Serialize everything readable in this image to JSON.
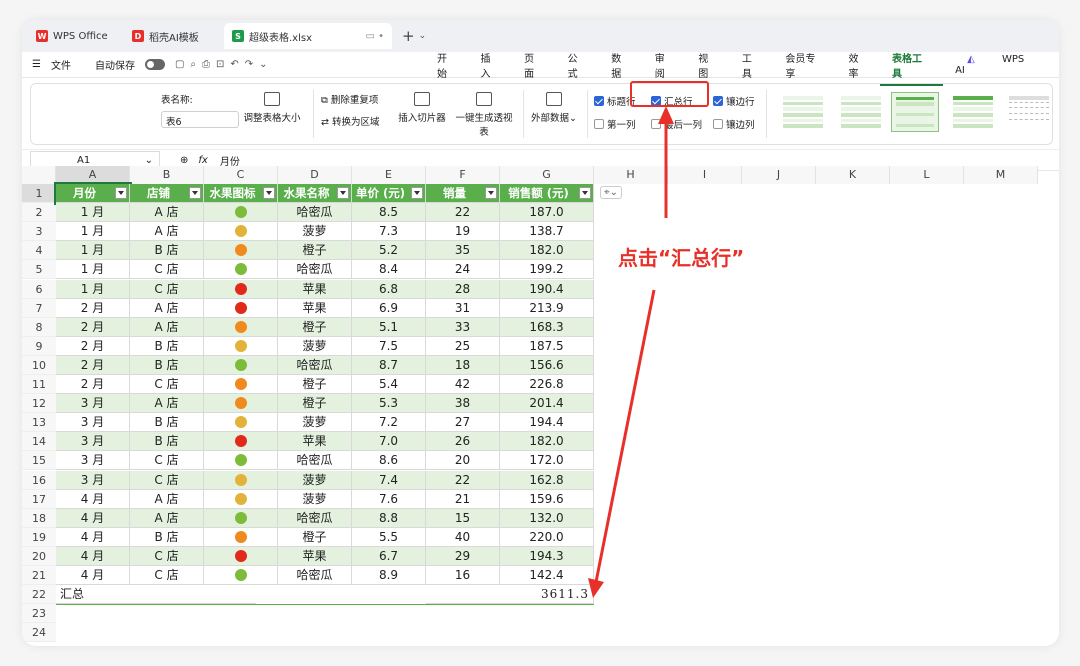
{
  "tabs": [
    {
      "label": "WPS Office",
      "icon": "wps-logo-icon"
    },
    {
      "label": "稻壳AI模板",
      "icon": "docer-icon"
    },
    {
      "label": "超级表格.xlsx",
      "icon": "spreadsheet-icon"
    }
  ],
  "menubar": {
    "file": "文件",
    "autosave": "自动保存",
    "menus": [
      "开始",
      "插入",
      "页面",
      "公式",
      "数据",
      "审阅",
      "视图",
      "工具",
      "会员专享",
      "效率",
      "表格工具"
    ],
    "wpsai": "WPS AI"
  },
  "ribbon": {
    "table_name_label": "表名称:",
    "table_name_value": "表6",
    "resize": "调整表格大小",
    "remove_dup": "删除重复项",
    "convert": "转换为区域",
    "slicer": "插入切片器",
    "pivot": "一键生成透视表",
    "external": "外部数据",
    "opts": {
      "header_row": "标题行",
      "total_row": "汇总行",
      "banded_rows": "镶边行",
      "first_col": "第一列",
      "last_col": "最后一列",
      "banded_cols": "镶边列"
    }
  },
  "formula_bar": {
    "cell_ref": "A1",
    "fx": "fx",
    "content": "月份"
  },
  "columns": [
    "A",
    "B",
    "C",
    "D",
    "E",
    "F",
    "G",
    "H",
    "I",
    "J",
    "K",
    "L",
    "M"
  ],
  "headers": [
    "月份",
    "店铺",
    "水果图标",
    "水果名称",
    "单价 (元)",
    "销量",
    "销售额 (元)"
  ],
  "rows": [
    [
      "1 月",
      "A 店",
      "melon",
      "哈密瓜",
      "8.5",
      "22",
      "187.0"
    ],
    [
      "1 月",
      "A 店",
      "pineapple",
      "菠萝",
      "7.3",
      "19",
      "138.7"
    ],
    [
      "1 月",
      "B 店",
      "orange",
      "橙子",
      "5.2",
      "35",
      "182.0"
    ],
    [
      "1 月",
      "C 店",
      "melon",
      "哈密瓜",
      "8.4",
      "24",
      "199.2"
    ],
    [
      "1 月",
      "C 店",
      "apple",
      "苹果",
      "6.8",
      "28",
      "190.4"
    ],
    [
      "2 月",
      "A 店",
      "apple",
      "苹果",
      "6.9",
      "31",
      "213.9"
    ],
    [
      "2 月",
      "A 店",
      "orange",
      "橙子",
      "5.1",
      "33",
      "168.3"
    ],
    [
      "2 月",
      "B 店",
      "pineapple",
      "菠萝",
      "7.5",
      "25",
      "187.5"
    ],
    [
      "2 月",
      "B 店",
      "melon",
      "哈密瓜",
      "8.7",
      "18",
      "156.6"
    ],
    [
      "2 月",
      "C 店",
      "orange",
      "橙子",
      "5.4",
      "42",
      "226.8"
    ],
    [
      "3 月",
      "A 店",
      "orange",
      "橙子",
      "5.3",
      "38",
      "201.4"
    ],
    [
      "3 月",
      "B 店",
      "pineapple",
      "菠萝",
      "7.2",
      "27",
      "194.4"
    ],
    [
      "3 月",
      "B 店",
      "apple",
      "苹果",
      "7.0",
      "26",
      "182.0"
    ],
    [
      "3 月",
      "C 店",
      "melon",
      "哈密瓜",
      "8.6",
      "20",
      "172.0"
    ],
    [
      "3 月",
      "C 店",
      "pineapple",
      "菠萝",
      "7.4",
      "22",
      "162.8"
    ],
    [
      "4 月",
      "A 店",
      "pineapple",
      "菠萝",
      "7.6",
      "21",
      "159.6"
    ],
    [
      "4 月",
      "A 店",
      "melon",
      "哈密瓜",
      "8.8",
      "15",
      "132.0"
    ],
    [
      "4 月",
      "B 店",
      "orange",
      "橙子",
      "5.5",
      "40",
      "220.0"
    ],
    [
      "4 月",
      "C 店",
      "apple",
      "苹果",
      "6.7",
      "29",
      "194.3"
    ],
    [
      "4 月",
      "C 店",
      "melon",
      "哈密瓜",
      "8.9",
      "16",
      "142.4"
    ]
  ],
  "total_row": {
    "label": "汇总",
    "value": "3611.3"
  },
  "row_numbers": [
    "1",
    "2",
    "3",
    "4",
    "5",
    "6",
    "7",
    "8",
    "9",
    "10",
    "11",
    "12",
    "13",
    "14",
    "15",
    "16",
    "17",
    "18",
    "19",
    "20",
    "21",
    "22",
    "23",
    "24"
  ],
  "annotation": "点击“汇总行”",
  "colors": {
    "header_green": "#5aae4c",
    "band_green": "#e3f1de",
    "annotation_red": "#e8302a"
  }
}
